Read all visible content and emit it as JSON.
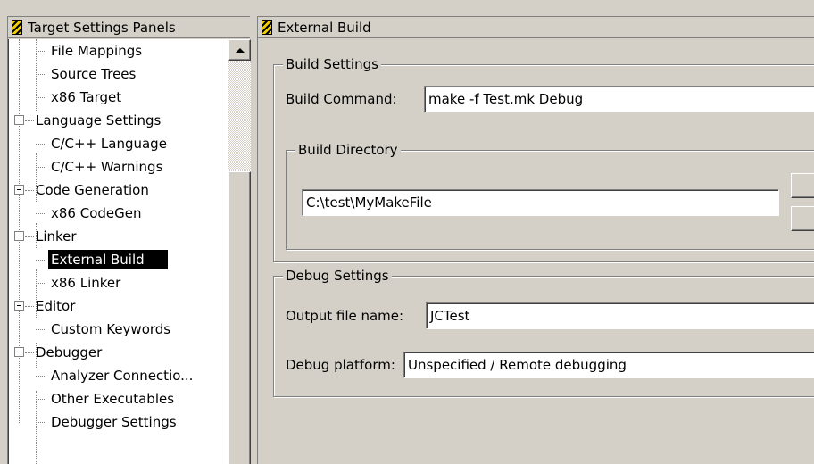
{
  "left_panel": {
    "title": "Target Settings Panels",
    "tree": [
      {
        "label": "File Mappings",
        "level": 1,
        "selected": false
      },
      {
        "label": "Source Trees",
        "level": 1,
        "selected": false
      },
      {
        "label": "x86 Target",
        "level": 1,
        "selected": false
      },
      {
        "label": "Language Settings",
        "level": 0,
        "expanded": true
      },
      {
        "label": "C/C++ Language",
        "level": 1,
        "selected": false
      },
      {
        "label": "C/C++ Warnings",
        "level": 1,
        "selected": false
      },
      {
        "label": "Code Generation",
        "level": 0,
        "expanded": true
      },
      {
        "label": "x86 CodeGen",
        "level": 1,
        "selected": false
      },
      {
        "label": "Linker",
        "level": 0,
        "expanded": true
      },
      {
        "label": "External Build",
        "level": 1,
        "selected": true
      },
      {
        "label": "x86 Linker",
        "level": 1,
        "selected": false
      },
      {
        "label": "Editor",
        "level": 0,
        "expanded": true
      },
      {
        "label": "Custom Keywords",
        "level": 1,
        "selected": false
      },
      {
        "label": "Debugger",
        "level": 0,
        "expanded": true
      },
      {
        "label": "Analyzer Connectio...",
        "level": 1,
        "selected": false
      },
      {
        "label": "Other Executables",
        "level": 1,
        "selected": false
      },
      {
        "label": "Debugger Settings",
        "level": 1,
        "selected": false
      }
    ]
  },
  "right_panel": {
    "title": "External Build",
    "build_settings": {
      "legend": "Build Settings",
      "command_label": "Build Command:",
      "command_value": "make -f Test.mk Debug",
      "directory": {
        "legend": "Build Directory",
        "path_value": "C:\\test\\MyMakeFile"
      }
    },
    "debug_settings": {
      "legend": "Debug Settings",
      "output_label": "Output file name:",
      "output_value": "JCTest",
      "platform_label": "Debug platform:",
      "platform_value": "Unspecified / Remote debugging"
    }
  },
  "colors": {
    "face": "#d4d0c8",
    "selection": "#000000",
    "window": "#ffffff"
  }
}
